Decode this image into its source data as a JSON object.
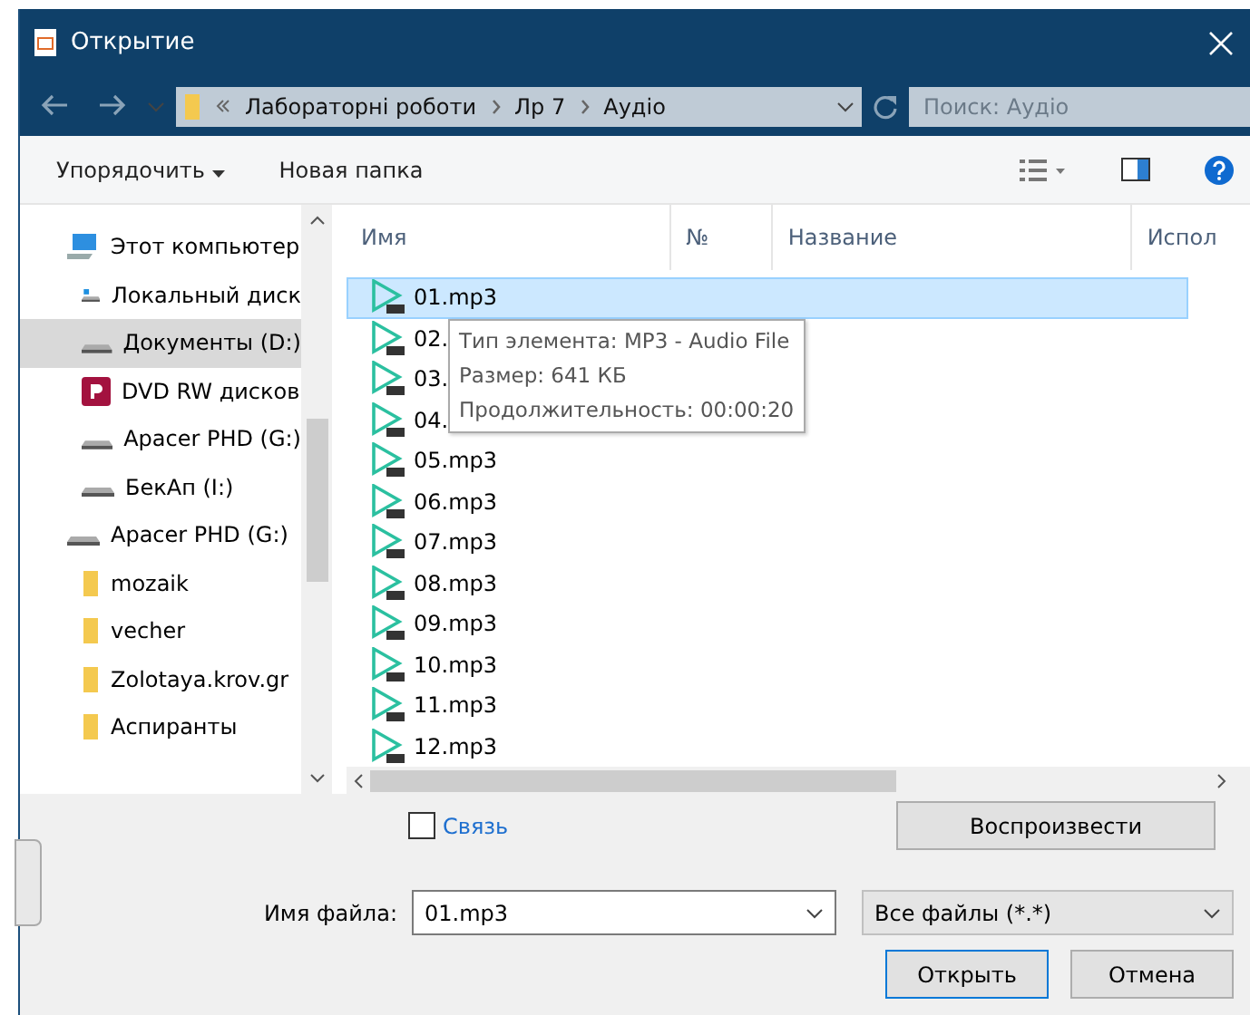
{
  "window": {
    "title": "Открытие"
  },
  "address": {
    "crumbs": [
      "Лабораторні роботи",
      "Лр 7",
      "Аудіо"
    ]
  },
  "search": {
    "placeholder": "Поиск: Аудіо"
  },
  "toolbar": {
    "organize": "Упорядочить",
    "new_folder": "Новая папка"
  },
  "sidebar": {
    "items": [
      {
        "label": "Этот компьютер",
        "kind": "computer",
        "selected": false,
        "children": [
          {
            "label": "Локальный диск",
            "kind": "system",
            "selected": false
          },
          {
            "label": "Документы (D:)",
            "kind": "drive",
            "selected": true
          },
          {
            "label": "DVD RW дисков",
            "kind": "dvd",
            "selected": false
          },
          {
            "label": "Apacer PHD (G:)",
            "kind": "drive",
            "selected": false
          },
          {
            "label": "БекАп (I:)",
            "kind": "drive",
            "selected": false
          }
        ]
      },
      {
        "label": "Apacer PHD (G:)",
        "kind": "drive",
        "selected": false,
        "children": [
          {
            "label": "mozaik",
            "kind": "folder",
            "selected": false
          },
          {
            "label": "vecher",
            "kind": "folder",
            "selected": false
          },
          {
            "label": "Zolotaya.krov.gr",
            "kind": "folder",
            "selected": false
          },
          {
            "label": "Аспиранты",
            "kind": "folder",
            "selected": false
          }
        ]
      }
    ]
  },
  "table": {
    "columns": [
      "Имя",
      "№",
      "Название",
      "Испол"
    ],
    "rows": [
      {
        "name": "01.mp3",
        "selected": true
      },
      {
        "name": "02.",
        "selected": false
      },
      {
        "name": "03.",
        "selected": false
      },
      {
        "name": "04.",
        "selected": false
      },
      {
        "name": "05.mp3",
        "selected": false
      },
      {
        "name": "06.mp3",
        "selected": false
      },
      {
        "name": "07.mp3",
        "selected": false
      },
      {
        "name": "08.mp3",
        "selected": false
      },
      {
        "name": "09.mp3",
        "selected": false
      },
      {
        "name": "10.mp3",
        "selected": false
      },
      {
        "name": "11.mp3",
        "selected": false
      },
      {
        "name": "12.mp3",
        "selected": false
      }
    ]
  },
  "tooltip": [
    "Тип элемента: MP3 - Audio File",
    "Размер: 641 КБ",
    "Продолжительность: 00:00:20"
  ],
  "link_checkbox": {
    "label": "Связь",
    "checked": false
  },
  "play_button": "Воспроизвести",
  "filename": {
    "label": "Имя файла:",
    "value": "01.mp3"
  },
  "filetype": "Все файлы (*.*)",
  "buttons": [
    "Открыть",
    "Отмена"
  ]
}
